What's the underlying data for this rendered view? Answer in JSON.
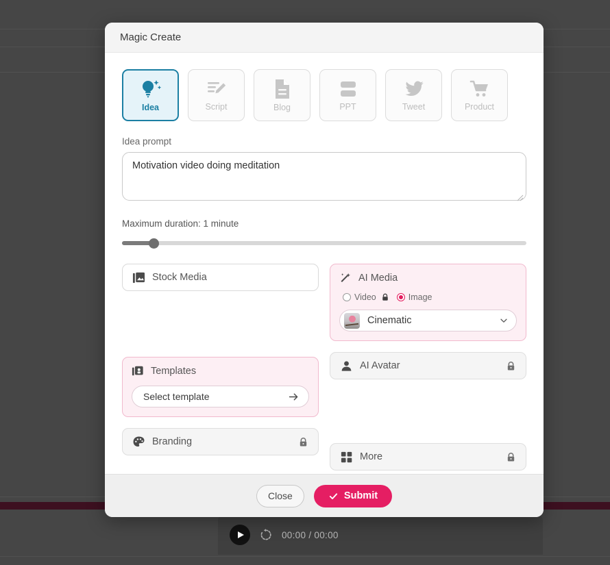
{
  "background": {
    "player": {
      "play_icon": "play-icon",
      "replay_icon": "replay-icon",
      "time": "00:00 / 00:00"
    }
  },
  "modal": {
    "title": "Magic Create",
    "type_selector": {
      "items": [
        {
          "label": "Idea",
          "icon": "lightbulb-sparkle-icon",
          "active": true
        },
        {
          "label": "Script",
          "icon": "script-pencil-icon",
          "active": false
        },
        {
          "label": "Blog",
          "icon": "document-icon",
          "active": false
        },
        {
          "label": "PPT",
          "icon": "slides-icon",
          "active": false
        },
        {
          "label": "Tweet",
          "icon": "twitter-bird-icon",
          "active": false
        },
        {
          "label": "Product",
          "icon": "shopping-cart-icon",
          "active": false
        }
      ]
    },
    "prompt": {
      "label": "Idea prompt",
      "value": "Motivation video doing meditation",
      "placeholder": ""
    },
    "duration": {
      "label": "Maximum duration: 1 minute",
      "percent": 6
    },
    "options": {
      "stock_media": {
        "label": "Stock Media",
        "icon": "image-stack-icon"
      },
      "ai_media": {
        "label": "AI Media",
        "icon": "magic-wand-icon",
        "radios": [
          {
            "label": "Video",
            "selected": false,
            "locked": true
          },
          {
            "label": "Image",
            "selected": true,
            "locked": false
          }
        ],
        "style": {
          "value": "Cinematic",
          "chevron": "chevron-down-icon"
        }
      },
      "templates": {
        "label": "Templates",
        "icon": "template-stack-icon",
        "button": {
          "label": "Select template",
          "icon": "arrow-right-icon"
        }
      },
      "ai_avatar": {
        "label": "AI Avatar",
        "icon": "person-icon",
        "locked": true
      },
      "branding": {
        "label": "Branding",
        "icon": "palette-icon",
        "locked": true
      },
      "more": {
        "label": "More",
        "icon": "grid-icon",
        "locked": true
      }
    },
    "footer": {
      "close_label": "Close",
      "submit_label": "Submit",
      "submit_icon": "check-icon"
    }
  },
  "colors": {
    "accent_pink": "#e51e63",
    "accent_teal": "#1b7fa3",
    "panel_pink_bg": "#fdeff4",
    "panel_pink_border": "#f1b9cd"
  }
}
